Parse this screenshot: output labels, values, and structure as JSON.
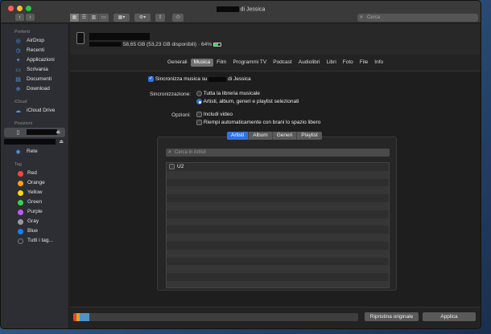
{
  "window": {
    "title_suffix": "di Jessica",
    "search_placeholder": "Cerca",
    "nav": {
      "back": "‹",
      "forward": "›"
    }
  },
  "sidebar": {
    "sections": {
      "favorites": "Preferiti",
      "icloud": "iCloud",
      "locations": "Posizioni",
      "tags": "Tag"
    },
    "favorites": [
      {
        "label": "AirDrop",
        "icon": "airdrop-icon",
        "glyph": "◎"
      },
      {
        "label": "Recenti",
        "icon": "clock-icon",
        "glyph": "◷"
      },
      {
        "label": "Applicazioni",
        "icon": "apps-icon",
        "glyph": "✦"
      },
      {
        "label": "Scrivania",
        "icon": "desktop-icon",
        "glyph": "▭"
      },
      {
        "label": "Documenti",
        "icon": "document-icon",
        "glyph": "▤"
      },
      {
        "label": "Download",
        "icon": "download-icon",
        "glyph": "⊕"
      }
    ],
    "icloud": [
      {
        "label": "iCloud Drive",
        "icon": "cloud-icon",
        "glyph": "☁"
      }
    ],
    "locations": [
      {
        "label": "Rete",
        "icon": "network-icon",
        "glyph": "◉"
      }
    ],
    "tags": [
      {
        "label": "Red",
        "color": "#ff453a"
      },
      {
        "label": "Orange",
        "color": "#ff9f0a"
      },
      {
        "label": "Yellow",
        "color": "#ffd60a"
      },
      {
        "label": "Green",
        "color": "#32d74b"
      },
      {
        "label": "Purple",
        "color": "#bf5af2"
      },
      {
        "label": "Gray",
        "color": "#98989d"
      },
      {
        "label": "Blue",
        "color": "#0a84ff"
      },
      {
        "label": "Tutti i tag...",
        "color": "#7a7a7a"
      }
    ]
  },
  "device": {
    "info": "58,65 GB (53,23 GB disponibili) · 64%",
    "battery_level": 0.64
  },
  "tabs": [
    {
      "label": "Generali",
      "active": false
    },
    {
      "label": "Musica",
      "active": true
    },
    {
      "label": "Film",
      "active": false
    },
    {
      "label": "Programmi TV",
      "active": false
    },
    {
      "label": "Podcast",
      "active": false
    },
    {
      "label": "Audiolibri",
      "active": false
    },
    {
      "label": "Libri",
      "active": false
    },
    {
      "label": "Foto",
      "active": false
    },
    {
      "label": "File",
      "active": false
    },
    {
      "label": "Info",
      "active": false
    }
  ],
  "music": {
    "sync_prefix": "Sincronizza musica su",
    "sync_suffix": "di Jessica",
    "sync_label": "Sincronizzazione:",
    "radio_all": "Tutta la libreria musicale",
    "radio_selected": "Artisti, album, generi e playlist selezionati",
    "options_label": "Opzioni:",
    "opt_video": "Includi video",
    "opt_fill": "Riempi automaticamente con brani lo spazio libero",
    "segments": [
      {
        "label": "Artisti",
        "active": true
      },
      {
        "label": "Album",
        "active": false
      },
      {
        "label": "Generi",
        "active": false
      },
      {
        "label": "Playlist",
        "active": false
      }
    ],
    "search_placeholder": "Cerca in Artisti",
    "artists": [
      "U2"
    ]
  },
  "bottom": {
    "restore": "Ripristina originale",
    "apply": "Applica",
    "storage": [
      {
        "color": "#e0413a",
        "fraction": 0.012
      },
      {
        "color": "#d9a51c",
        "fraction": 0.01
      },
      {
        "color": "#4f93c9",
        "fraction": 0.035
      }
    ]
  }
}
